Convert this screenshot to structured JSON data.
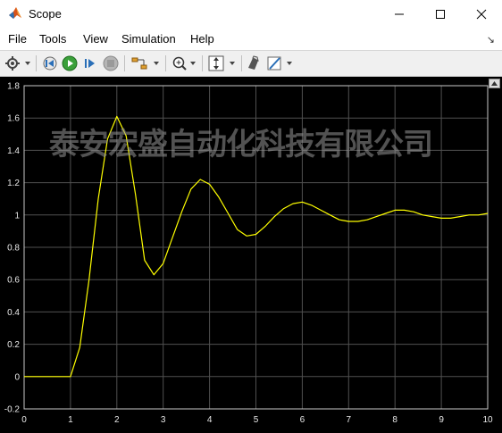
{
  "window": {
    "title": "Scope"
  },
  "menu": {
    "items": [
      "File",
      "Tools",
      "View",
      "Simulation",
      "Help"
    ]
  },
  "toolbar": {
    "icons": [
      "gear-icon",
      "step-back-icon",
      "run-icon",
      "step-forward-icon",
      "stop-icon",
      "signal-select-icon",
      "zoom-icon",
      "autoscale-icon",
      "highlight-icon",
      "style-icon"
    ]
  },
  "watermark": {
    "text": "泰安宏盛自动化科技有限公司"
  },
  "colors": {
    "trace": "#ffff00",
    "background": "#000000",
    "grid": "#505050",
    "axes": "#c8c8c8"
  },
  "chart_data": {
    "type": "line",
    "title": "",
    "xlabel": "",
    "ylabel": "",
    "xlim": [
      0,
      10
    ],
    "ylim": [
      -0.2,
      1.8
    ],
    "xticks": [
      "0",
      "1",
      "2",
      "3",
      "4",
      "5",
      "6",
      "7",
      "8",
      "9",
      "10"
    ],
    "yticks": [
      "-0.2",
      "0",
      "0.2",
      "0.4",
      "0.6",
      "0.8",
      "1",
      "1.2",
      "1.4",
      "1.6",
      "1.8"
    ],
    "grid": true,
    "series": [
      {
        "color": "#ffff00",
        "x": [
          0,
          1.0,
          1.2,
          1.4,
          1.6,
          1.8,
          2.0,
          2.2,
          2.4,
          2.6,
          2.8,
          3.0,
          3.2,
          3.4,
          3.6,
          3.8,
          4.0,
          4.2,
          4.4,
          4.6,
          4.8,
          5.0,
          5.2,
          5.4,
          5.6,
          5.8,
          6.0,
          6.2,
          6.4,
          6.6,
          6.8,
          7.0,
          7.2,
          7.4,
          7.6,
          7.8,
          8.0,
          8.2,
          8.4,
          8.6,
          8.8,
          9.0,
          9.2,
          9.4,
          9.6,
          9.8,
          10.0
        ],
        "y": [
          0,
          0,
          0.18,
          0.6,
          1.1,
          1.47,
          1.61,
          1.49,
          1.13,
          0.72,
          0.63,
          0.7,
          0.86,
          1.02,
          1.16,
          1.22,
          1.19,
          1.11,
          1.01,
          0.91,
          0.87,
          0.88,
          0.93,
          0.99,
          1.04,
          1.07,
          1.08,
          1.06,
          1.03,
          1.0,
          0.97,
          0.96,
          0.96,
          0.97,
          0.99,
          1.01,
          1.03,
          1.03,
          1.02,
          1.0,
          0.99,
          0.98,
          0.98,
          0.99,
          1.0,
          1.0,
          1.01
        ]
      }
    ]
  }
}
